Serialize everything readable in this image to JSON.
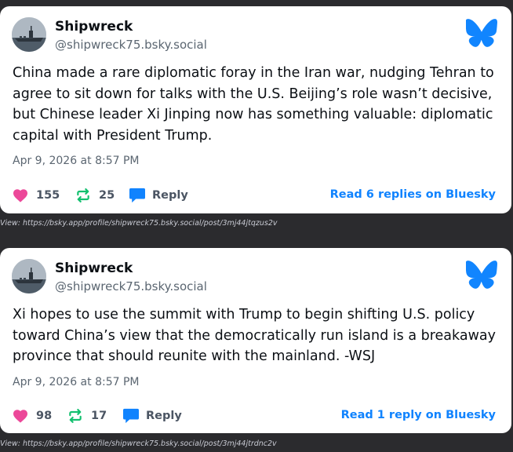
{
  "posts": [
    {
      "author": "Shipwreck",
      "handle": "@shipwreck75.bsky.social",
      "text": "China made a rare diplomatic foray in the Iran war, nudging Tehran to agree to sit down for talks with the U.S. Beijing’s role wasn’t decisive, but Chinese leader Xi Jinping now has something valuable: diplomatic capital with President Trump.",
      "date": "Apr 9, 2026 at 8:57 PM",
      "likes": "155",
      "reposts": "25",
      "reply_label": "Reply",
      "read_link": "Read 6 replies on Bluesky",
      "view_url": "View: https://bsky.app/profile/shipwreck75.bsky.social/post/3mj44jtqzus2v"
    },
    {
      "author": "Shipwreck",
      "handle": "@shipwreck75.bsky.social",
      "text": "Xi hopes to use the summit with Trump to begin shifting U.S. policy toward China’s view that the democratically run island is a breakaway province that should reunite with the mainland. -WSJ",
      "date": "Apr 9, 2026 at 8:57 PM",
      "likes": "98",
      "reposts": "17",
      "reply_label": "Reply",
      "read_link": "Read 1 reply on Bluesky",
      "view_url": "View: https://bsky.app/profile/shipwreck75.bsky.social/post/3mj44jtrdnc2v"
    }
  ],
  "icons": {
    "avatar": "aircraft-carrier-avatar",
    "logo": "bluesky-butterfly-icon",
    "like": "heart-icon",
    "repost": "repost-icon",
    "reply": "reply-bubble-icon"
  },
  "colors": {
    "page_bg": "#2b2b2e",
    "card_bg": "#ffffff",
    "heart": "#ec4899",
    "repost": "#13c06f",
    "reply": "#1083fe",
    "link": "#1083fe",
    "bluesky": "#1185fe"
  }
}
